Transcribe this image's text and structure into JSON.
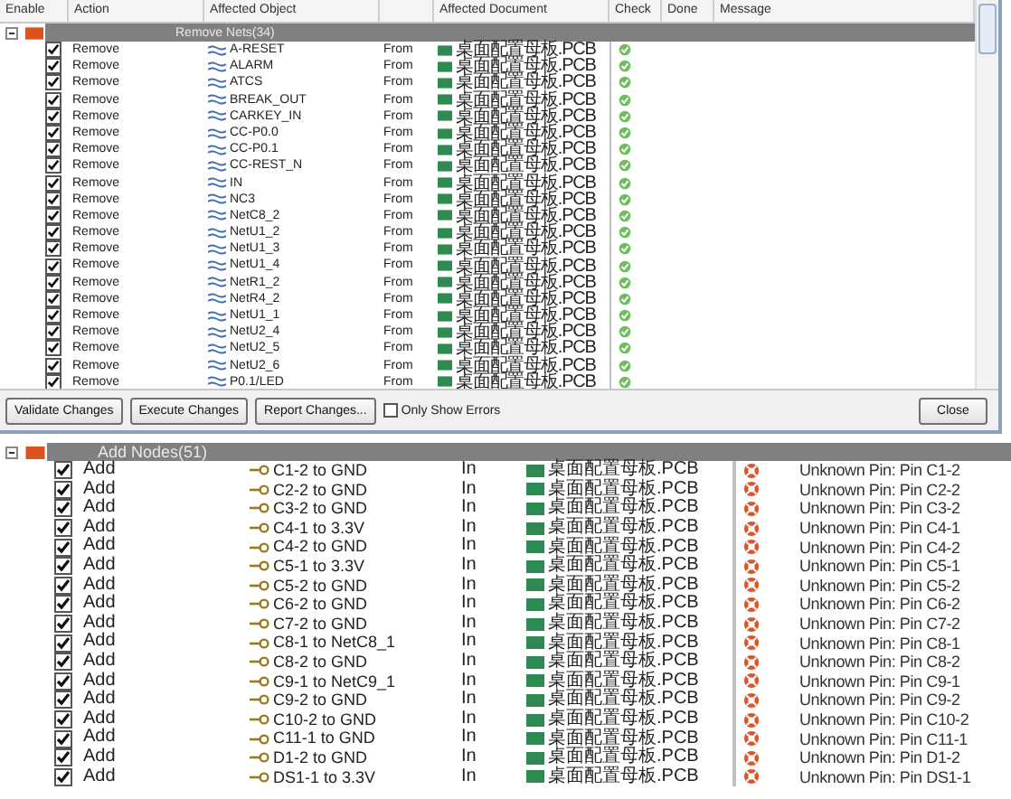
{
  "top": {
    "columns": [
      "Enable",
      "Action",
      "Affected Object",
      "Affected Document",
      "Check",
      "Done",
      "Message"
    ],
    "group": {
      "label": "Remove Nets(34)",
      "expanded": true
    },
    "rows": [
      {
        "enabled": true,
        "action": "Remove",
        "object": "A-RESET",
        "direction": "From",
        "document": "桌面配置母板.PCB",
        "kind": "ok"
      },
      {
        "enabled": true,
        "action": "Remove",
        "object": "ALARM",
        "direction": "From",
        "document": "桌面配置母板.PCB",
        "kind": "ok"
      },
      {
        "enabled": true,
        "action": "Remove",
        "object": "ATCS",
        "direction": "From",
        "document": "桌面配置母板.PCB",
        "kind": "ok"
      },
      {
        "enabled": true,
        "action": "Remove",
        "object": "BREAK_OUT",
        "direction": "From",
        "document": "桌面配置母板.PCB",
        "kind": "ok"
      },
      {
        "enabled": true,
        "action": "Remove",
        "object": "CARKEY_IN",
        "direction": "From",
        "document": "桌面配置母板.PCB",
        "kind": "ok"
      },
      {
        "enabled": true,
        "action": "Remove",
        "object": "CC-P0.0",
        "direction": "From",
        "document": "桌面配置母板.PCB",
        "kind": "ok"
      },
      {
        "enabled": true,
        "action": "Remove",
        "object": "CC-P0.1",
        "direction": "From",
        "document": "桌面配置母板.PCB",
        "kind": "ok"
      },
      {
        "enabled": true,
        "action": "Remove",
        "object": "CC-REST_N",
        "direction": "From",
        "document": "桌面配置母板.PCB",
        "kind": "ok"
      },
      {
        "enabled": true,
        "action": "Remove",
        "object": "IN",
        "direction": "From",
        "document": "桌面配置母板.PCB",
        "kind": "ok"
      },
      {
        "enabled": true,
        "action": "Remove",
        "object": "NC3",
        "direction": "From",
        "document": "桌面配置母板.PCB",
        "kind": "ok"
      },
      {
        "enabled": true,
        "action": "Remove",
        "object": "NetC8_2",
        "direction": "From",
        "document": "桌面配置母板.PCB",
        "kind": "ok"
      },
      {
        "enabled": true,
        "action": "Remove",
        "object": "NetU1_2",
        "direction": "From",
        "document": "桌面配置母板.PCB",
        "kind": "ok"
      },
      {
        "enabled": true,
        "action": "Remove",
        "object": "NetU1_3",
        "direction": "From",
        "document": "桌面配置母板.PCB",
        "kind": "ok"
      },
      {
        "enabled": true,
        "action": "Remove",
        "object": "NetU1_4",
        "direction": "From",
        "document": "桌面配置母板.PCB",
        "kind": "ok"
      },
      {
        "enabled": true,
        "action": "Remove",
        "object": "NetR1_2",
        "direction": "From",
        "document": "桌面配置母板.PCB",
        "kind": "ok"
      },
      {
        "enabled": true,
        "action": "Remove",
        "object": "NetR4_2",
        "direction": "From",
        "document": "桌面配置母板.PCB",
        "kind": "ok"
      },
      {
        "enabled": true,
        "action": "Remove",
        "object": "NetU1_1",
        "direction": "From",
        "document": "桌面配置母板.PCB",
        "kind": "ok"
      },
      {
        "enabled": true,
        "action": "Remove",
        "object": "NetU2_4",
        "direction": "From",
        "document": "桌面配置母板.PCB",
        "kind": "ok"
      },
      {
        "enabled": true,
        "action": "Remove",
        "object": "NetU2_5",
        "direction": "From",
        "document": "桌面配置母板.PCB",
        "kind": "ok"
      },
      {
        "enabled": true,
        "action": "Remove",
        "object": "NetU2_6",
        "direction": "From",
        "document": "桌面配置母板.PCB",
        "kind": "ok"
      },
      {
        "enabled": true,
        "action": "Remove",
        "object": "P0.1/LED",
        "direction": "From",
        "document": "桌面配置母板.PCB",
        "kind": "ok"
      }
    ]
  },
  "buttons": [
    "Validate Changes",
    "Execute Changes",
    "Report Changes..."
  ],
  "only_show_errors": {
    "label": "Only Show Errors",
    "checked": false
  },
  "close": "Close",
  "bottom": {
    "group": {
      "label": "Add Nodes(51)",
      "expanded": true
    },
    "rows": [
      {
        "enabled": true,
        "action": "Add",
        "object": "C1-2 to GND",
        "direction": "In",
        "document": "桌面配置母板.PCB",
        "kind": "error",
        "message": "Unknown Pin: Pin C1-2"
      },
      {
        "enabled": true,
        "action": "Add",
        "object": "C2-2 to GND",
        "direction": "In",
        "document": "桌面配置母板.PCB",
        "kind": "error",
        "message": "Unknown Pin: Pin C2-2"
      },
      {
        "enabled": true,
        "action": "Add",
        "object": "C3-2 to GND",
        "direction": "In",
        "document": "桌面配置母板.PCB",
        "kind": "error",
        "message": "Unknown Pin: Pin C3-2"
      },
      {
        "enabled": true,
        "action": "Add",
        "object": "C4-1 to 3.3V",
        "direction": "In",
        "document": "桌面配置母板.PCB",
        "kind": "error",
        "message": "Unknown Pin: Pin C4-1"
      },
      {
        "enabled": true,
        "action": "Add",
        "object": "C4-2 to GND",
        "direction": "In",
        "document": "桌面配置母板.PCB",
        "kind": "error",
        "message": "Unknown Pin: Pin C4-2"
      },
      {
        "enabled": true,
        "action": "Add",
        "object": "C5-1 to 3.3V",
        "direction": "In",
        "document": "桌面配置母板.PCB",
        "kind": "error",
        "message": "Unknown Pin: Pin C5-1"
      },
      {
        "enabled": true,
        "action": "Add",
        "object": "C5-2 to GND",
        "direction": "In",
        "document": "桌面配置母板.PCB",
        "kind": "error",
        "message": "Unknown Pin: Pin C5-2"
      },
      {
        "enabled": true,
        "action": "Add",
        "object": "C6-2 to GND",
        "direction": "In",
        "document": "桌面配置母板.PCB",
        "kind": "error",
        "message": "Unknown Pin: Pin C6-2"
      },
      {
        "enabled": true,
        "action": "Add",
        "object": "C7-2 to GND",
        "direction": "In",
        "document": "桌面配置母板.PCB",
        "kind": "error",
        "message": "Unknown Pin: Pin C7-2"
      },
      {
        "enabled": true,
        "action": "Add",
        "object": "C8-1 to NetC8_1",
        "direction": "In",
        "document": "桌面配置母板.PCB",
        "kind": "error",
        "message": "Unknown Pin: Pin C8-1"
      },
      {
        "enabled": true,
        "action": "Add",
        "object": "C8-2 to GND",
        "direction": "In",
        "document": "桌面配置母板.PCB",
        "kind": "error",
        "message": "Unknown Pin: Pin C8-2"
      },
      {
        "enabled": true,
        "action": "Add",
        "object": "C9-1 to NetC9_1",
        "direction": "In",
        "document": "桌面配置母板.PCB",
        "kind": "error",
        "message": "Unknown Pin: Pin C9-1"
      },
      {
        "enabled": true,
        "action": "Add",
        "object": "C9-2 to GND",
        "direction": "In",
        "document": "桌面配置母板.PCB",
        "kind": "error",
        "message": "Unknown Pin: Pin C9-2"
      },
      {
        "enabled": true,
        "action": "Add",
        "object": "C10-2 to GND",
        "direction": "In",
        "document": "桌面配置母板.PCB",
        "kind": "error",
        "message": "Unknown Pin: Pin C10-2"
      },
      {
        "enabled": true,
        "action": "Add",
        "object": "C11-1 to GND",
        "direction": "In",
        "document": "桌面配置母板.PCB",
        "kind": "error",
        "message": "Unknown Pin: Pin C11-1"
      },
      {
        "enabled": true,
        "action": "Add",
        "object": "D1-2 to GND",
        "direction": "In",
        "document": "桌面配置母板.PCB",
        "kind": "error",
        "message": "Unknown Pin: Pin D1-2"
      },
      {
        "enabled": true,
        "action": "Add",
        "object": "DS1-1 to 3.3V",
        "direction": "In",
        "document": "桌面配置母板.PCB",
        "kind": "error",
        "message": "Unknown Pin: Pin DS1-1"
      }
    ]
  }
}
